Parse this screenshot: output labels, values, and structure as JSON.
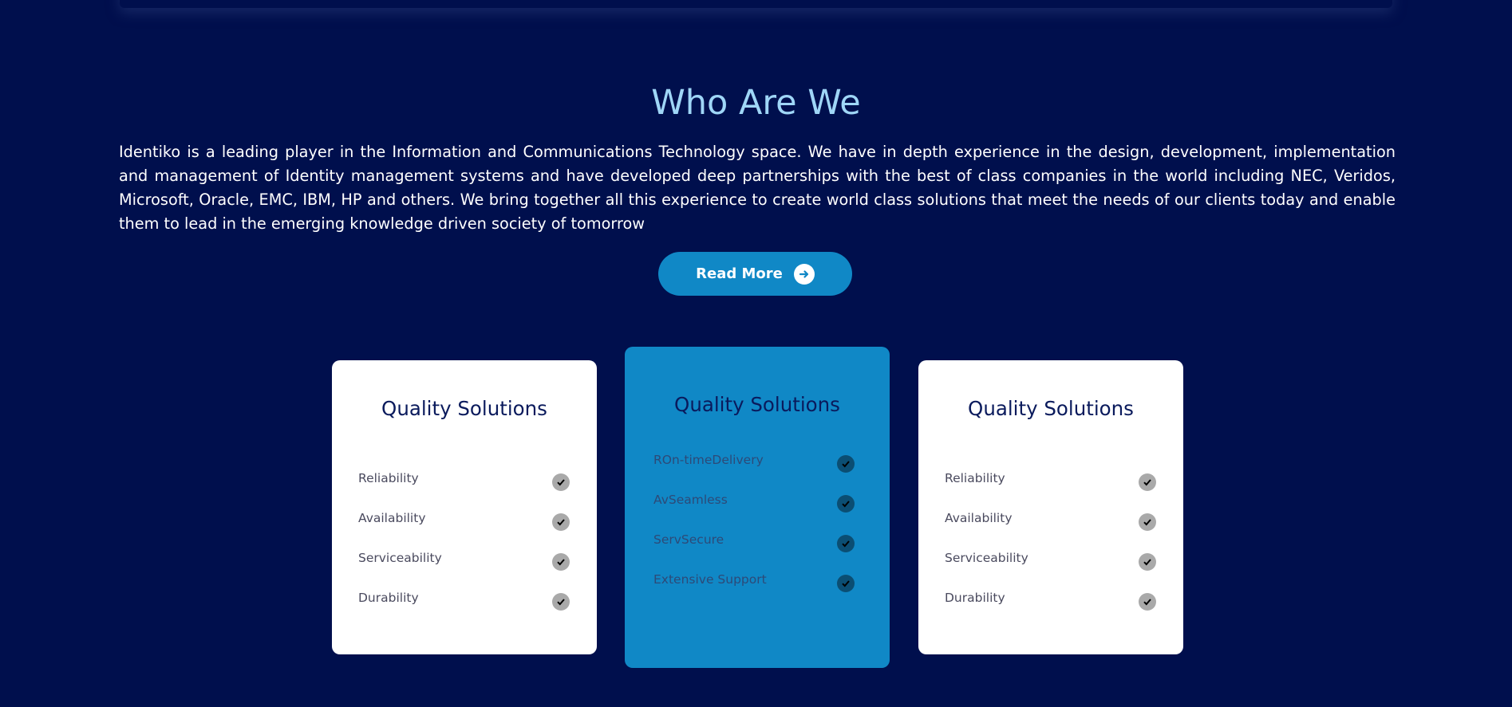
{
  "section": {
    "title": "Who Are We",
    "intro": "Identiko is a leading player in the Information and Communications Technology space. We have in depth experience in the design, development, implementation and management of Identity management systems and have developed deep partnerships with the best of class companies in the world including NEC, Veridos, Microsoft, Oracle, EMC, IBM, HP and others. We bring together all this experience to create world class solutions that meet the needs of our clients today and enable them to lead in the emerging knowledge driven society of tomorrow",
    "read_more_label": "Read More",
    "read_more_icon": "arrow-right-circle-icon"
  },
  "colors": {
    "background": "#000f4d",
    "title": "#9fd6f7",
    "accent": "#1088c6",
    "card_white": "#ffffff"
  },
  "cards": [
    {
      "title": "Quality Solutions",
      "style": "white",
      "items": [
        {
          "label": "Reliability",
          "icon": "check-icon"
        },
        {
          "label": "Availability",
          "icon": "check-icon"
        },
        {
          "label": "Serviceability",
          "icon": "check-icon"
        },
        {
          "label": "Durability",
          "icon": "check-icon"
        }
      ]
    },
    {
      "title": "Quality Solutions",
      "style": "blue",
      "items": [
        {
          "label": "ROn-timeDelivery",
          "icon": "check-icon"
        },
        {
          "label": "AvSeamless",
          "icon": "check-icon"
        },
        {
          "label": "ServSecure",
          "icon": "check-icon"
        },
        {
          "label": "Extensive Support",
          "icon": "check-icon"
        }
      ]
    },
    {
      "title": "Quality Solutions",
      "style": "white",
      "items": [
        {
          "label": "Reliability",
          "icon": "check-icon"
        },
        {
          "label": "Availability",
          "icon": "check-icon"
        },
        {
          "label": "Serviceability",
          "icon": "check-icon"
        },
        {
          "label": "Durability",
          "icon": "check-icon"
        }
      ]
    }
  ]
}
